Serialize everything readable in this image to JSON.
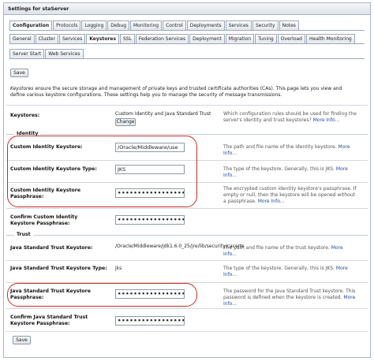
{
  "window": {
    "title": "Settings for staServer"
  },
  "primary_tabs": [
    "Configuration",
    "Protocols",
    "Logging",
    "Debug",
    "Monitoring",
    "Control",
    "Deployments",
    "Services",
    "Security",
    "Notes"
  ],
  "secondary_tabs": [
    "General",
    "Cluster",
    "Services",
    "Keystores",
    "SSL",
    "Federation Services",
    "Deployment",
    "Migration",
    "Tuning",
    "Overload",
    "Health Monitoring"
  ],
  "tertiary_tabs": [
    "Server Start",
    "Web Services"
  ],
  "active": {
    "primary": "Configuration",
    "secondary": "Keystores"
  },
  "save_label": "Save",
  "description": {
    "italic": "Keystores",
    "text": " ensure the secure storage and management of private keys and trusted certificate authorities (CAs). This page lets you view and define various keystore configurations. These settings help you to manage the security of message transmissions."
  },
  "keystores": {
    "label": "Keystores:",
    "value": "Custom Identity and Java Standard Trust",
    "change_label": "Change",
    "help": "Which configuration rules should be used for finding the server's identity and trust keystores?",
    "more": "More Info..."
  },
  "sections": {
    "identity": "Identity",
    "trust": "Trust"
  },
  "identity": {
    "keystore": {
      "label": "Custom Identity Keystore:",
      "value": "/Oracle/Middleware/use",
      "help": "The path and file name of the identity keystore.",
      "more": "More Info..."
    },
    "keystore_type": {
      "label": "Custom Identity Keystore Type:",
      "value": "JKS",
      "help": "The type of the keystore. Generally, this is JKS.",
      "more": "More Info..."
    },
    "passphrase": {
      "label": "Custom Identity Keystore Passphrase:",
      "value": "••••••••••••••••••••",
      "help": "The encrypted custom identity keystore's passphrase. If empty or null, then the keystore will be opened without a passphrase.",
      "more": "More Info..."
    },
    "confirm": {
      "label": "Confirm Custom Identity Keystore Passphrase:",
      "value": "••••••••••••••••••••"
    }
  },
  "trust": {
    "keystore": {
      "label": "Java Standard Trust Keystore:",
      "value": "/Oracle/Middleware/jdk1.6.0_25/jre/lib/security/cacerts",
      "help": "The path and file name of the trust keystore.",
      "more": "More Info..."
    },
    "keystore_type": {
      "label": "Java Standard Trust Keystore Type:",
      "value": "jks",
      "help": "The type of the keystore. Generally, this is JKS.",
      "more": "More Info..."
    },
    "passphrase": {
      "label": "Java Standard Trust Keystore Passphrase:",
      "value": "••••••••••••••••••••",
      "help": "The password for the Java Standard Trust keystore. This password is defined when the keystore is created.",
      "more": "More Info..."
    },
    "confirm": {
      "label": "Confirm Java Standard Trust Keystore Passphrase:",
      "value": "••••••••••••••••••••"
    }
  },
  "colors": {
    "highlight_oval": "#cf2a2a",
    "link": "#1d4c9e",
    "tab_border": "#9aa9b8"
  }
}
